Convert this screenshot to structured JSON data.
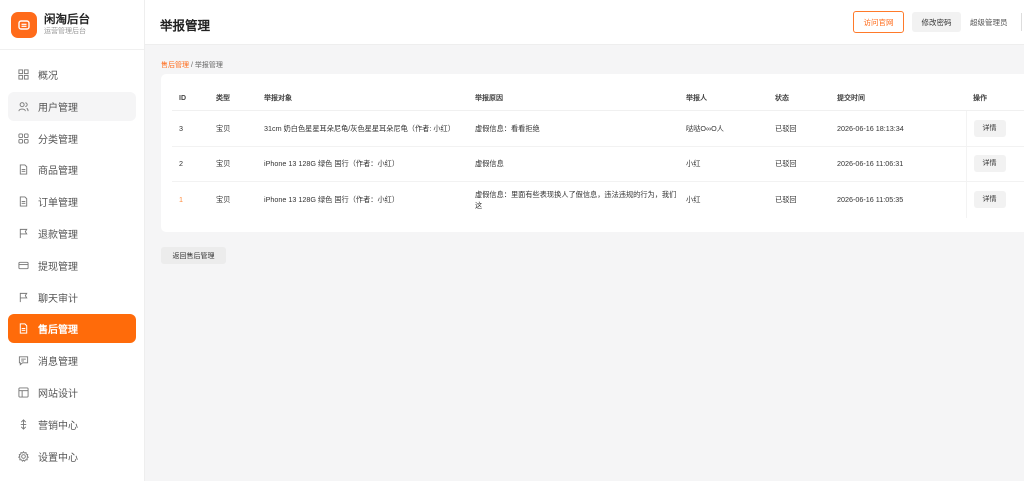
{
  "brand": {
    "title": "闲淘后台",
    "subtitle": "运营管理后台"
  },
  "sidebar": {
    "items": [
      {
        "label": "概况",
        "icon": "grid-icon"
      },
      {
        "label": "用户管理",
        "icon": "users-icon"
      },
      {
        "label": "分类管理",
        "icon": "category-icon"
      },
      {
        "label": "商品管理",
        "icon": "document-icon"
      },
      {
        "label": "订单管理",
        "icon": "document-icon"
      },
      {
        "label": "退款管理",
        "icon": "flag-icon"
      },
      {
        "label": "提现管理",
        "icon": "card-icon"
      },
      {
        "label": "聊天审计",
        "icon": "flag-icon"
      },
      {
        "label": "售后管理",
        "icon": "document-icon",
        "active": true
      },
      {
        "label": "消息管理",
        "icon": "message-icon"
      },
      {
        "label": "网站设计",
        "icon": "layout-icon"
      },
      {
        "label": "营销中心",
        "icon": "marketing-icon"
      },
      {
        "label": "设置中心",
        "icon": "gear-icon"
      }
    ]
  },
  "header": {
    "title": "举报管理",
    "visit_site": "访问官网",
    "change_password": "修改密码",
    "admin": "超级管理员"
  },
  "breadcrumb": {
    "parent": "售后管理",
    "separator": "/",
    "current": "举报管理"
  },
  "table": {
    "columns": [
      "ID",
      "类型",
      "举报对象",
      "举报原因",
      "举报人",
      "状态",
      "提交时间",
      "操作"
    ],
    "rows": [
      {
        "id": "3",
        "type": "宝贝",
        "target": "31cm 奶白色星星耳朵尼龟/灰色星星耳朵尼龟（作者: 小红）",
        "reason": "虚假信息：看看拒绝",
        "reporter": "哒哒O∞O人",
        "status": "已驳回",
        "time": "2026-06-16 18:13:34",
        "action": "详情"
      },
      {
        "id": "2",
        "type": "宝贝",
        "target": "iPhone 13 128G 绿色 国行（作者：小红）",
        "reason": "虚假信息",
        "reporter": "小红",
        "status": "已驳回",
        "time": "2026-06-16 11:06:31",
        "action": "详情"
      },
      {
        "id": "1",
        "type": "宝贝",
        "target": "iPhone 13 128G 绿色 国行（作者：小红）",
        "reason": "虚假信息：里面有些表现换人了假信息，违法违规的行为，我们这",
        "reporter": "小红",
        "status": "已驳回",
        "time": "2026-06-16 11:05:35",
        "action": "详情"
      }
    ]
  },
  "back_button": "返回售后管理",
  "colors": {
    "accent": "#ff6b0a",
    "sidebar_bg": "#ffffff",
    "page_bg": "#f5f5f6"
  }
}
